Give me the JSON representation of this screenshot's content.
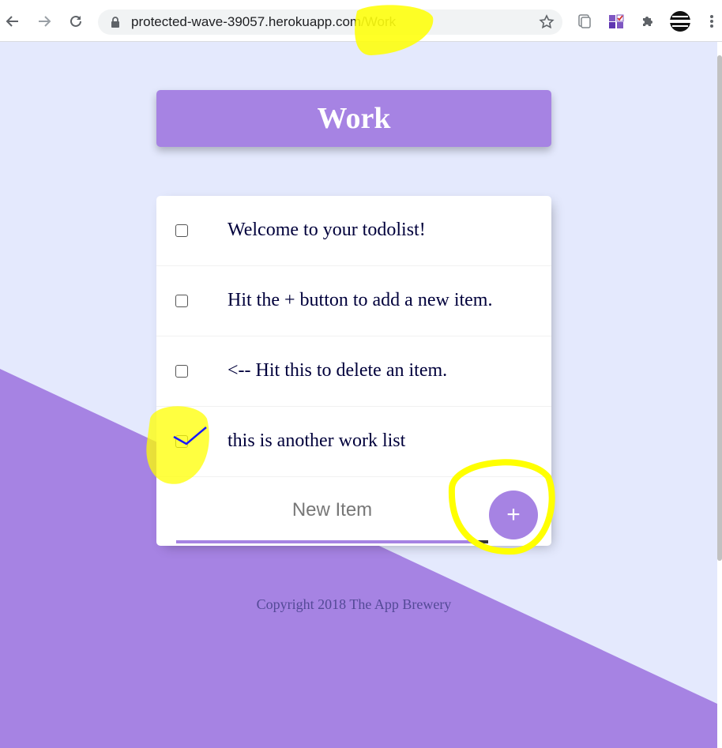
{
  "browser": {
    "url_host": "protected-wave-39057.herokuapp.com",
    "url_path": "/Work",
    "back_icon": "arrow-left-icon",
    "forward_icon": "arrow-right-icon",
    "reload_icon": "reload-icon",
    "lock_icon": "lock-icon",
    "star_icon": "star-icon",
    "extensions": [
      "tab-manager-icon",
      "checklist-extension-icon",
      "puzzle-icon",
      "profile-avatar-icon",
      "more-vert-icon"
    ]
  },
  "colors": {
    "background": "#E4E9FD",
    "accent": "#A683E3",
    "text": "#00003B",
    "footer_text": "#534996",
    "highlight": "#FFFF00"
  },
  "heading": {
    "title": "Work"
  },
  "list": {
    "items": [
      {
        "label": "Welcome to your todolist!",
        "checked": false
      },
      {
        "label": "Hit the + button to add a new item.",
        "checked": false
      },
      {
        "label": "<-- Hit this to delete an item.",
        "checked": false
      },
      {
        "label": "this is another work list",
        "checked": false
      }
    ],
    "new_item_placeholder": "New Item",
    "add_button_label": "+"
  },
  "footer": {
    "text": "Copyright 2018 The App Brewery"
  }
}
